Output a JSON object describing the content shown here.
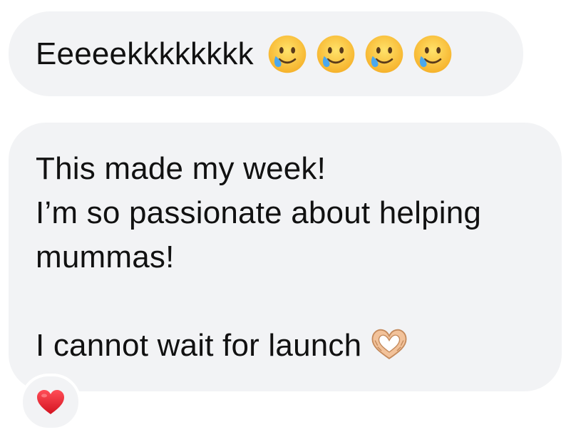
{
  "messages": [
    {
      "text": "Eeeeekkkkkkkk",
      "emoji": [
        "smiling-face-with-tear",
        "smiling-face-with-tear",
        "smiling-face-with-tear",
        "smiling-face-with-tear"
      ]
    },
    {
      "lines": [
        "This made my week!",
        "I’m so passionate about helping",
        "mummas!",
        "",
        "I cannot wait for launch"
      ],
      "trailing_emoji": "heart-hands"
    }
  ],
  "reaction": {
    "emoji": "red-heart"
  },
  "colors": {
    "bubble_bg": "#f2f3f5",
    "text": "#111111",
    "page_bg": "#ffffff",
    "heart": "#e0202e"
  }
}
